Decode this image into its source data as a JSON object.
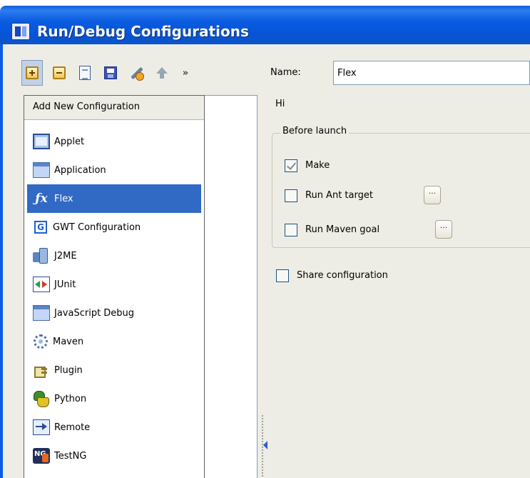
{
  "window": {
    "title": "Run/Debug Configurations"
  },
  "toolbar": {
    "add_tooltip": "Add New Configuration",
    "more_label": "»"
  },
  "name_field": {
    "label": "Name:",
    "value": "Flex"
  },
  "popup": {
    "header": "Add New Configuration",
    "items": [
      {
        "label": "Applet",
        "icon": "applet-icon"
      },
      {
        "label": "Application",
        "icon": "application-icon"
      },
      {
        "label": "Flex",
        "icon": "flex-icon",
        "selected": true
      },
      {
        "label": "GWT Configuration",
        "icon": "gwt-icon"
      },
      {
        "label": "J2ME",
        "icon": "j2me-icon"
      },
      {
        "label": "JUnit",
        "icon": "junit-icon"
      },
      {
        "label": "JavaScript Debug",
        "icon": "javascript-debug-icon"
      },
      {
        "label": "Maven",
        "icon": "maven-icon"
      },
      {
        "label": "Plugin",
        "icon": "plugin-icon"
      },
      {
        "label": "Python",
        "icon": "python-icon"
      },
      {
        "label": "Remote",
        "icon": "remote-icon"
      },
      {
        "label": "TestNG",
        "icon": "testng-icon"
      }
    ]
  },
  "details": {
    "hint": "Hi",
    "before_launch": {
      "legend": "Before launch",
      "make_label": "Make",
      "make_checked": true,
      "ant_label": "Run Ant target",
      "ant_checked": false,
      "maven_label": "Run Maven goal",
      "maven_checked": false,
      "ellipsis": "···"
    },
    "share_label": "Share configuration",
    "share_checked": false
  },
  "colors": {
    "title_bar": "#0b5ce0",
    "selection": "#316ac5",
    "dialog_bg": "#eeede5"
  }
}
